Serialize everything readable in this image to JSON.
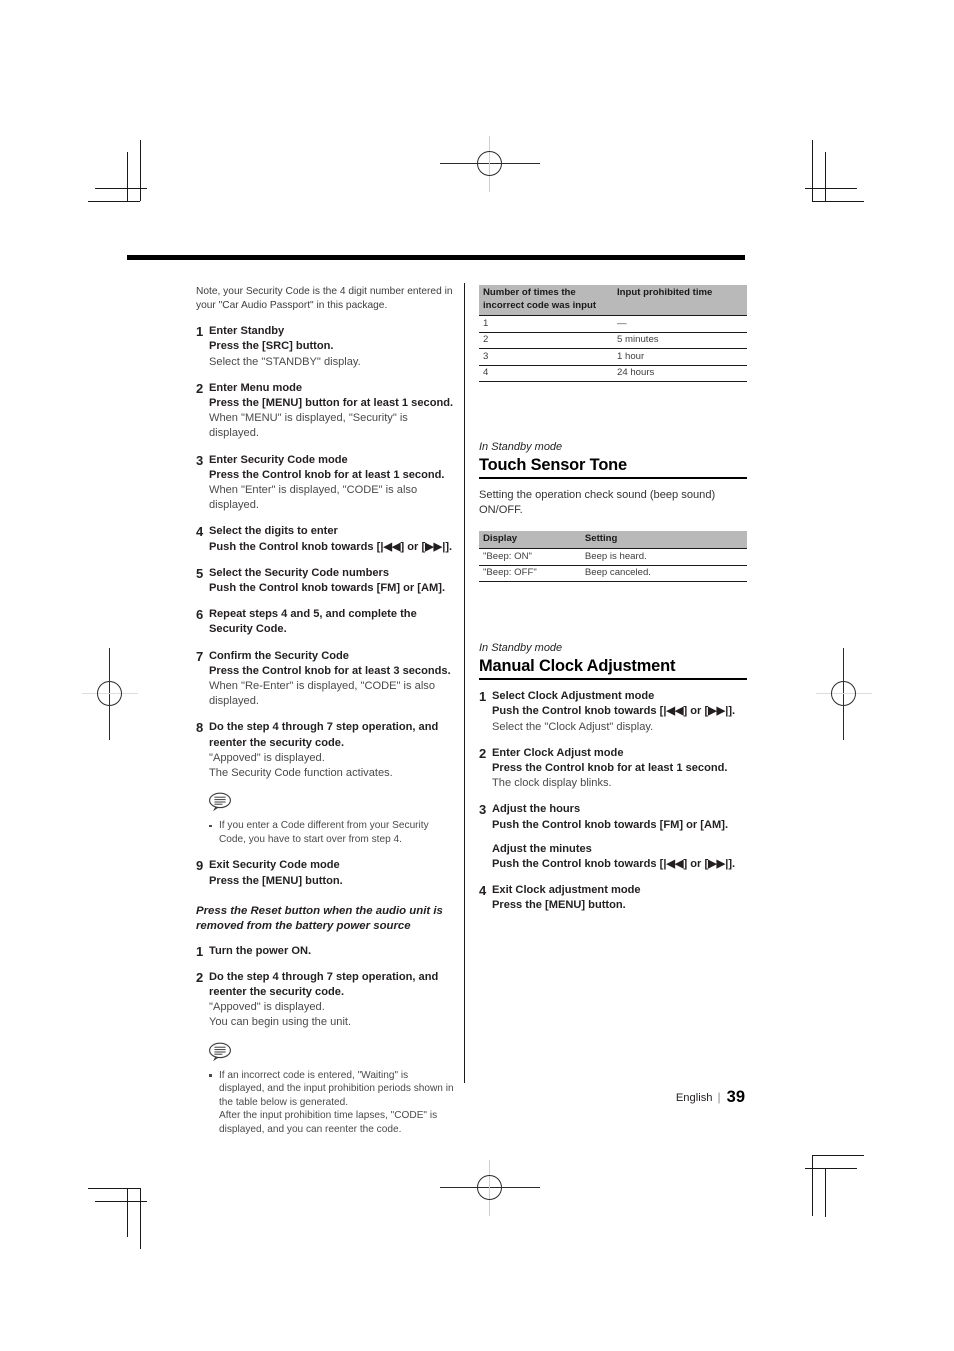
{
  "page": {
    "footer_language": "English",
    "footer_separator": "|",
    "footer_page_number": "39"
  },
  "left_column": {
    "intro": "Note, your Security Code is the 4 digit number entered in your \"Car Audio Passport\" in this package.",
    "steps": [
      {
        "num": "1",
        "lines": [
          {
            "style": "bold",
            "text": "Enter Standby"
          },
          {
            "style": "bold",
            "text": "Press the [SRC] button."
          },
          {
            "style": "normal",
            "text": "Select the \"STANDBY\" display."
          }
        ]
      },
      {
        "num": "2",
        "lines": [
          {
            "style": "bold",
            "text": "Enter Menu mode"
          },
          {
            "style": "bold",
            "text": "Press the [MENU] button for at least 1 second."
          },
          {
            "style": "normal",
            "text": "When \"MENU\" is displayed, \"Security\" is displayed."
          }
        ]
      },
      {
        "num": "3",
        "lines": [
          {
            "style": "bold",
            "text": "Enter Security Code mode"
          },
          {
            "style": "bold",
            "text": "Press the Control knob for at least 1 second."
          },
          {
            "style": "normal",
            "text": "When \"Enter\" is displayed, \"CODE\" is also displayed."
          }
        ]
      },
      {
        "num": "4",
        "lines": [
          {
            "style": "bold",
            "text": "Select the digits to enter"
          },
          {
            "style": "bold",
            "text": "Push the Control knob towards [|◀◀] or [▶▶|]."
          }
        ]
      },
      {
        "num": "5",
        "lines": [
          {
            "style": "bold",
            "text": "Select the Security Code numbers"
          },
          {
            "style": "bold",
            "text": "Push the Control knob towards [FM] or [AM]."
          }
        ]
      },
      {
        "num": "6",
        "lines": [
          {
            "style": "bold",
            "text": "Repeat steps 4 and 5, and complete the Security Code."
          }
        ]
      },
      {
        "num": "7",
        "lines": [
          {
            "style": "bold",
            "text": "Confirm the Security Code"
          },
          {
            "style": "bold",
            "text": "Press the Control knob for at least 3 seconds."
          },
          {
            "style": "normal",
            "text": "When \"Re-Enter\" is displayed, \"CODE\" is also displayed."
          }
        ]
      },
      {
        "num": "8",
        "lines": [
          {
            "style": "bold",
            "text": "Do the step 4 through 7 step operation, and reenter the security code."
          },
          {
            "style": "normal",
            "text": "\"Appoved\" is displayed."
          },
          {
            "style": "normal",
            "text": "The Security Code function activates."
          }
        ]
      }
    ],
    "note_1": {
      "icon": "memo-bubble-icon",
      "items": [
        {
          "text": "If you enter a Code different from your Security Code, you have to start over from step 4."
        }
      ]
    },
    "step_9": {
      "num": "9",
      "lines": [
        {
          "style": "bold",
          "text": "Exit Security Code mode"
        },
        {
          "style": "bold",
          "text": "Press the [MENU] button."
        }
      ]
    },
    "reset_heading": "Press the Reset button when the audio unit is removed from the battery power source",
    "reset_steps": [
      {
        "num": "1",
        "lines": [
          {
            "style": "bold",
            "text": "Turn the power ON."
          }
        ]
      },
      {
        "num": "2",
        "lines": [
          {
            "style": "bold",
            "text": "Do the step 4 through 7 step operation, and reenter the security code."
          },
          {
            "style": "normal",
            "text": "\"Appoved\" is displayed."
          },
          {
            "style": "normal",
            "text": "You can begin using the unit."
          }
        ]
      }
    ],
    "note_2": {
      "icon": "memo-bubble-icon",
      "items": [
        {
          "text": "If an incorrect code is entered, \"Waiting\" is displayed, and the input prohibition periods shown in the table below is generated.",
          "continuation": "After the input prohibition time lapses, \"CODE\" is displayed, and you can reenter the code."
        }
      ]
    }
  },
  "right_column": {
    "prohibit_table": {
      "headers": [
        "Number of times the incorrect code was input",
        "Input prohibited time"
      ],
      "rows": [
        [
          "1",
          "—"
        ],
        [
          "2",
          "5 minutes"
        ],
        [
          "3",
          "1 hour"
        ],
        [
          "4",
          "24 hours"
        ]
      ]
    },
    "touch_sensor": {
      "mode_label": "In Standby mode",
      "heading": "Touch Sensor Tone",
      "description": "Setting the operation check sound (beep sound) ON/OFF.",
      "table": {
        "headers": [
          "Display",
          "Setting"
        ],
        "rows": [
          [
            "\"Beep: ON\"",
            "Beep is heard."
          ],
          [
            "\"Beep: OFF\"",
            "Beep canceled."
          ]
        ]
      }
    },
    "clock": {
      "mode_label": "In Standby mode",
      "heading": "Manual Clock Adjustment",
      "steps": [
        {
          "num": "1",
          "lines": [
            {
              "style": "bold",
              "text": "Select Clock Adjustment mode"
            },
            {
              "style": "bold",
              "text": "Push the Control knob towards [|◀◀] or [▶▶|]."
            },
            {
              "style": "normal",
              "text": "Select the \"Clock Adjust\" display."
            }
          ]
        },
        {
          "num": "2",
          "lines": [
            {
              "style": "bold",
              "text": "Enter Clock Adjust mode"
            },
            {
              "style": "bold",
              "text": "Press the Control knob for at least 1 second."
            },
            {
              "style": "normal",
              "text": "The clock display blinks."
            }
          ]
        },
        {
          "num": "3",
          "lines": [
            {
              "style": "bold",
              "text": "Adjust the hours"
            },
            {
              "style": "bold",
              "text": "Push the Control knob towards [FM] or [AM]."
            },
            {
              "style": "gap",
              "text": ""
            },
            {
              "style": "bold",
              "text": "Adjust the minutes"
            },
            {
              "style": "bold",
              "text": "Push the Control knob towards [|◀◀] or [▶▶|]."
            }
          ]
        },
        {
          "num": "4",
          "lines": [
            {
              "style": "bold",
              "text": "Exit Clock adjustment mode"
            },
            {
              "style": "bold",
              "text": "Press the [MENU] button."
            }
          ]
        }
      ]
    }
  }
}
